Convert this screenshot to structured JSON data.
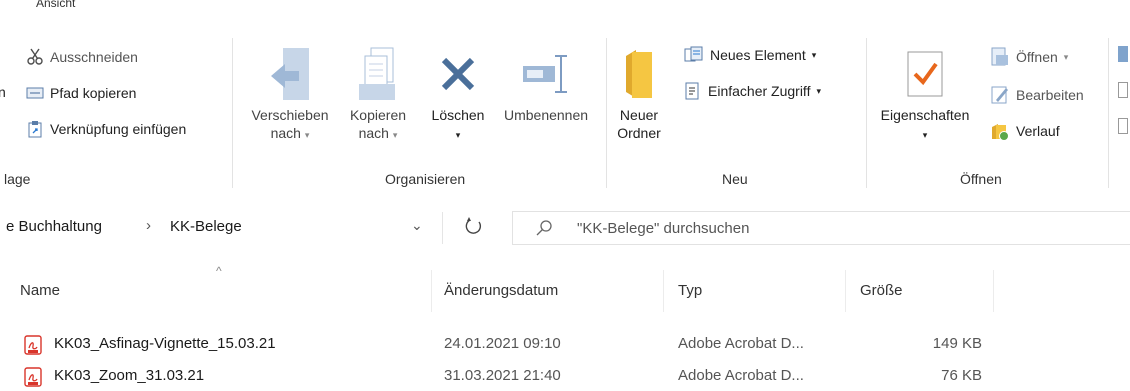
{
  "tab": {
    "label": "Ansicht"
  },
  "ribbon": {
    "clipboard": {
      "cut": "Ausschneiden",
      "copy_path": "Pfad kopieren",
      "paste_shortcut": "Verknüpfung einfügen",
      "group_label": "lage"
    },
    "organize": {
      "move_to_line1": "Verschieben",
      "move_to_line2": "nach",
      "copy_to_line1": "Kopieren",
      "copy_to_line2": "nach",
      "delete": "Löschen",
      "rename": "Umbenennen",
      "group_label": "Organisieren"
    },
    "new": {
      "new_folder_line1": "Neuer",
      "new_folder_line2": "Ordner",
      "new_item": "Neues Element",
      "easy_access": "Einfacher Zugriff",
      "group_label": "Neu"
    },
    "open": {
      "properties": "Eigenschaften",
      "open": "Öffnen",
      "edit": "Bearbeiten",
      "history": "Verlauf",
      "group_label": "Öffnen"
    }
  },
  "address": {
    "crumb_parent": "e Buchhaltung",
    "crumb_separator": "›",
    "crumb_current": "KK-Belege"
  },
  "search": {
    "placeholder": "\"KK-Belege\" durchsuchen"
  },
  "columns": {
    "name": "Name",
    "date": "Änderungsdatum",
    "type": "Typ",
    "size": "Größe"
  },
  "files": [
    {
      "name": "KK03_Asfinag-Vignette_15.03.21",
      "date": "24.01.2021 09:10",
      "type": "Adobe Acrobat D...",
      "size": "149 KB"
    },
    {
      "name": "KK03_Zoom_31.03.21",
      "date": "31.03.2021 21:40",
      "type": "Adobe Acrobat D...",
      "size": "76 KB"
    }
  ],
  "colors": {
    "accent_blue": "#2b79d0",
    "delete_blue": "#4a6f9a",
    "folder_yellow": "#f5c642",
    "pdf_red": "#d9352b",
    "check_orange": "#e8671c"
  }
}
